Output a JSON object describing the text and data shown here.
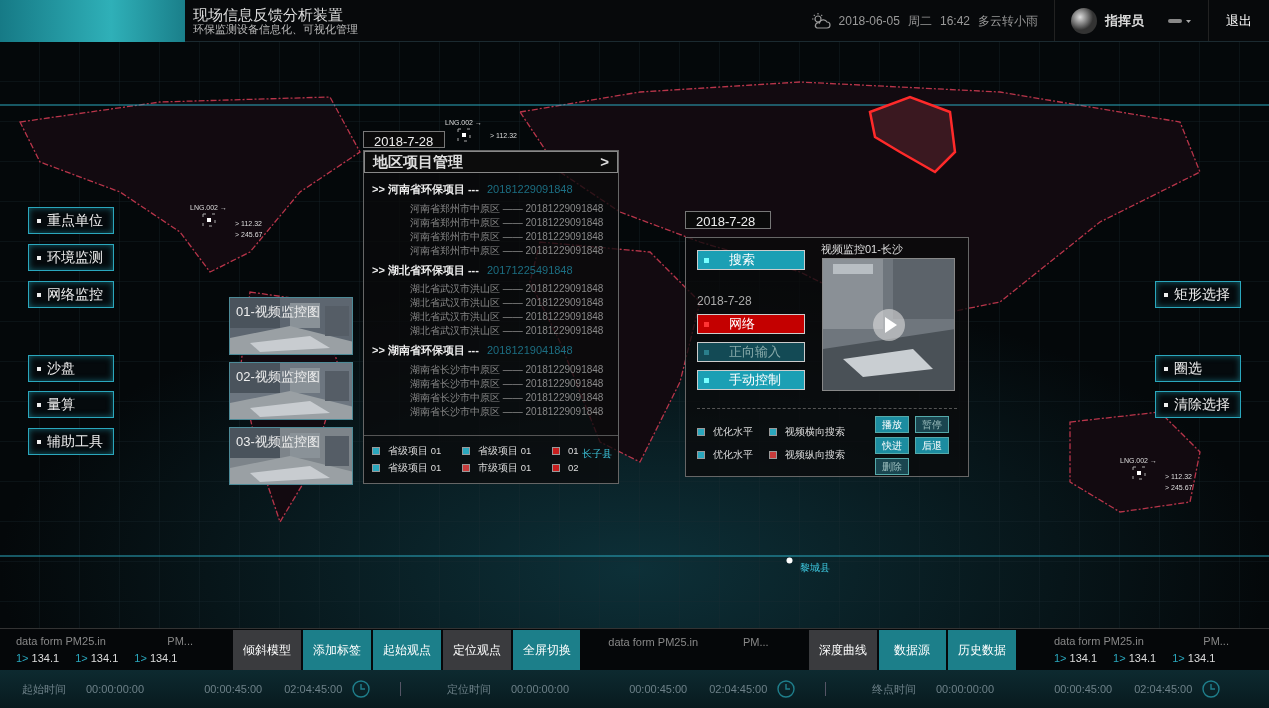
{
  "header": {
    "title": "现场信息反馈分析装置",
    "subtitle": "环保监测设备信息化、可视化管理",
    "date": "2018-06-05",
    "weekday": "周二",
    "time": "16:42",
    "weather": "多云转小雨",
    "user": "指挥员",
    "logout": "退出"
  },
  "left_menu": [
    {
      "label": "重点单位"
    },
    {
      "label": "环境监测"
    },
    {
      "label": "网络监控"
    },
    {
      "label": "沙盘"
    },
    {
      "label": "量算"
    },
    {
      "label": "辅助工具"
    }
  ],
  "right_menu": [
    {
      "label": "矩形选择"
    },
    {
      "label": "圈选"
    },
    {
      "label": "清除选择"
    }
  ],
  "map_markers": [
    {
      "code": "LNG.002 →",
      "values": [
        "> 112.32",
        "> 245.67"
      ]
    },
    {
      "code": "LNG.002 →",
      "values": [
        "> 112.32"
      ]
    },
    {
      "code": "LNG.002 →",
      "values": [
        "> 112.32",
        "> 245.67"
      ]
    }
  ],
  "map_places": [
    "长子县",
    "黎城县"
  ],
  "video_thumbs": [
    {
      "label": "01-视频监控图"
    },
    {
      "label": "02-视频监控图"
    },
    {
      "label": "03-视频监控图"
    }
  ],
  "project_panel": {
    "date": "2018-7-28",
    "title": "地区项目管理",
    "arrow": ">",
    "groups": [
      {
        "title": ">> 河南省环保项目 ---",
        "code": "20181229091848",
        "items": [
          "河南省郑州市中原区 —— 20181229091848",
          "河南省郑州市中原区 —— 20181229091848",
          "河南省郑州市中原区 —— 20181229091848",
          "河南省郑州市中原区 —— 20181229091848"
        ]
      },
      {
        "title": ">> 湖北省环保项目 ---",
        "code": "20171225491848",
        "items": [
          "湖北省武汉市洪山区 —— 20181229091848",
          "湖北省武汉市洪山区 —— 20181229091848",
          "湖北省武汉市洪山区 —— 20181229091848",
          "湖北省武汉市洪山区 —— 20181229091848"
        ]
      },
      {
        "title": ">> 湖南省环保项目 ---",
        "code": "20181219041848",
        "items": [
          "湖南省长沙市中原区 —— 20181229091848",
          "湖南省长沙市中原区 —— 20181229091848",
          "湖南省长沙市中原区 —— 20181229091848",
          "湖南省长沙市中原区 —— 20181229091848"
        ]
      }
    ],
    "legend": [
      {
        "label": "省级项目 01",
        "color": "#2aa7bd"
      },
      {
        "label": "省级项目 01",
        "color": "#2aa7bd"
      },
      {
        "label": "01",
        "color": "#c81e1e"
      },
      {
        "label": "省级项目 01",
        "color": "#2aa7bd"
      },
      {
        "label": "市级项目 01",
        "color": "#c83c3c"
      },
      {
        "label": "02",
        "color": "#c81e1e"
      }
    ]
  },
  "video_panel": {
    "date": "2018-7-28",
    "date2": "2018-7-28",
    "video_title": "视频监控01-长沙",
    "buttons": [
      {
        "label": "搜索",
        "kind": "cyan"
      },
      {
        "label": "网络",
        "kind": "red"
      },
      {
        "label": "正向输入",
        "kind": "dim"
      },
      {
        "label": "手动控制",
        "kind": "cyan"
      }
    ],
    "options": [
      {
        "label": "优化水平",
        "color": "#2aa7bd"
      },
      {
        "label": "视频横向搜索",
        "color": "#2aa7bd"
      },
      {
        "label": "优化水平",
        "color": "#2aa7bd"
      },
      {
        "label": "视频纵向搜索",
        "color": "#c83c3c"
      }
    ],
    "actions": [
      {
        "label": "播放",
        "kind": "bright"
      },
      {
        "label": "暂停",
        "kind": "dark"
      },
      {
        "label": "快进",
        "kind": "bright"
      },
      {
        "label": "后退",
        "kind": "bright"
      },
      {
        "label": "删除",
        "kind": "dark"
      }
    ]
  },
  "toolbar": {
    "data_blocks": [
      {
        "source": "data form PM25.in",
        "pm": "PM...",
        "readings": [
          {
            "prefix": "1>",
            "value": "134.1"
          },
          {
            "prefix": "1>",
            "value": "134.1"
          },
          {
            "prefix": "1>",
            "value": "134.1"
          }
        ]
      },
      {
        "source": "data form PM25.in",
        "pm": "PM..."
      },
      {
        "source": "data form PM25.in",
        "pm": "PM...",
        "readings": [
          {
            "prefix": "1>",
            "value": "134.1"
          },
          {
            "prefix": "1>",
            "value": "134.1"
          },
          {
            "prefix": "1>",
            "value": "134.1"
          }
        ]
      }
    ],
    "groups": [
      [
        {
          "label": "倾斜模型",
          "selected": false
        },
        {
          "label": "添加标签",
          "selected": true
        },
        {
          "label": "起始观点",
          "selected": true
        },
        {
          "label": "定位观点",
          "selected": false
        },
        {
          "label": "全屏切换",
          "selected": true
        }
      ],
      [
        {
          "label": "深度曲线",
          "selected": false
        },
        {
          "label": "数据源",
          "selected": true
        },
        {
          "label": "历史数据",
          "selected": true
        }
      ]
    ]
  },
  "time_bar": [
    {
      "label": "起始时间",
      "times": [
        "00:00:00:00",
        "00:00:45:00",
        "02:04:45:00"
      ]
    },
    {
      "label": "定位时间",
      "times": [
        "00:00:00:00",
        "00:00:45:00",
        "02:04:45:00"
      ]
    },
    {
      "label": "终点时间",
      "times": [
        "00:00:00:00",
        "00:00:45:00",
        "02:04:45:00"
      ]
    }
  ]
}
